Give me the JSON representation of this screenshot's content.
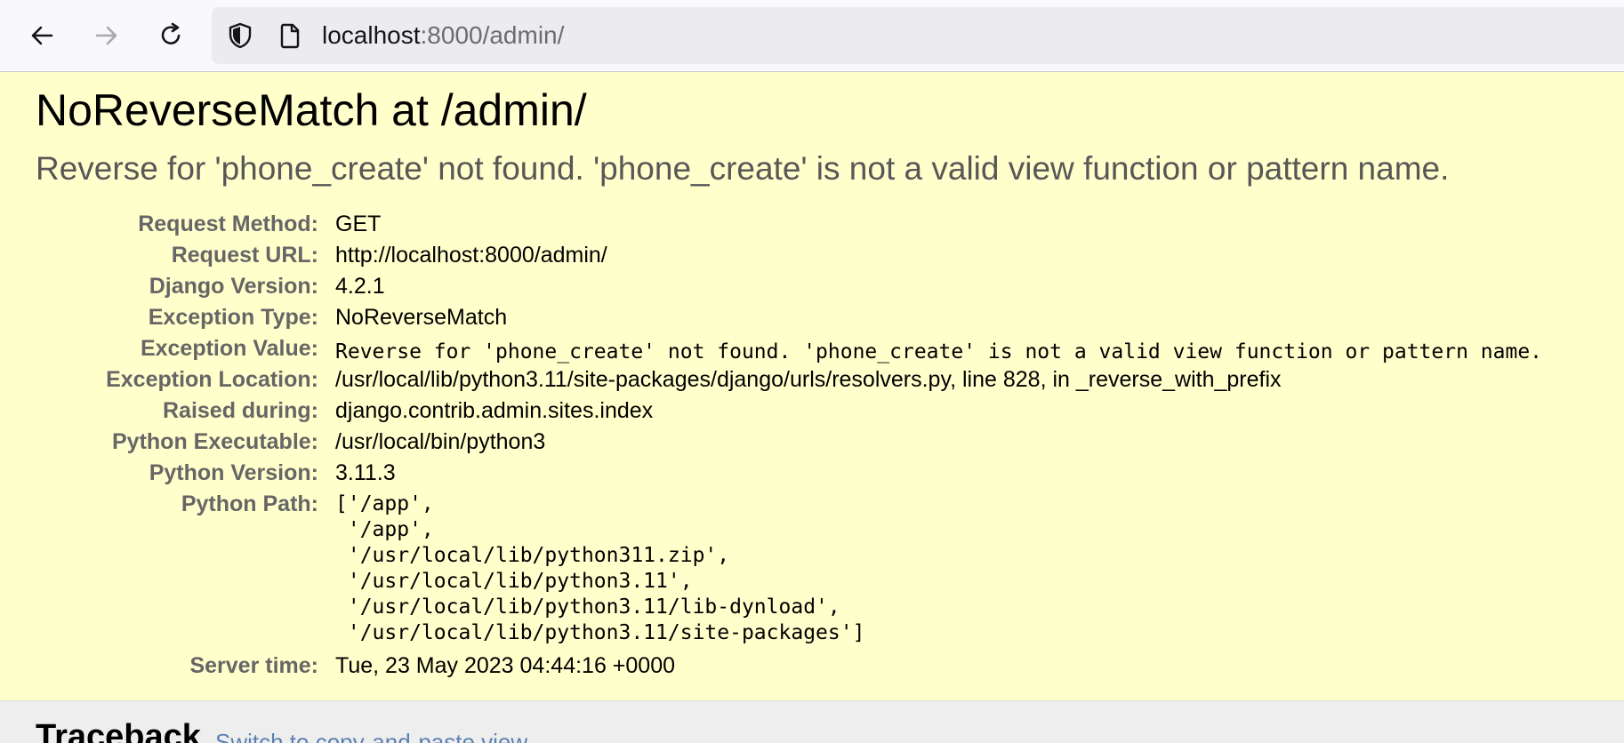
{
  "browser": {
    "url_host": "localhost",
    "url_rest": ":8000/admin/",
    "icons": [
      "back-arrow-icon",
      "forward-arrow-icon",
      "reload-icon",
      "shield-icon",
      "page-icon"
    ]
  },
  "error": {
    "title": "NoReverseMatch at /admin/",
    "message": "Reverse for 'phone_create' not found. 'phone_create' is not a valid view function or pattern name."
  },
  "meta": {
    "request_method": {
      "label": "Request Method:",
      "value": "GET"
    },
    "request_url": {
      "label": "Request URL:",
      "value": "http://localhost:8000/admin/"
    },
    "django_version": {
      "label": "Django Version:",
      "value": "4.2.1"
    },
    "exception_type": {
      "label": "Exception Type:",
      "value": "NoReverseMatch"
    },
    "exception_value": {
      "label": "Exception Value:",
      "value": "Reverse for 'phone_create' not found. 'phone_create' is not a valid view function or pattern name."
    },
    "exception_location": {
      "label": "Exception Location:",
      "value": "/usr/local/lib/python3.11/site-packages/django/urls/resolvers.py, line 828, in _reverse_with_prefix"
    },
    "raised_during": {
      "label": "Raised during:",
      "value": "django.contrib.admin.sites.index"
    },
    "python_executable": {
      "label": "Python Executable:",
      "value": "/usr/local/bin/python3"
    },
    "python_version": {
      "label": "Python Version:",
      "value": "3.11.3"
    },
    "python_path": {
      "label": "Python Path:",
      "lines": [
        "['/app',",
        " '/app',",
        " '/usr/local/lib/python311.zip',",
        " '/usr/local/lib/python3.11',",
        " '/usr/local/lib/python3.11/lib-dynload',",
        " '/usr/local/lib/python3.11/site-packages']"
      ]
    },
    "server_time": {
      "label": "Server time:",
      "value": "Tue, 23 May 2023 04:44:16 +0000"
    }
  },
  "traceback": {
    "heading": "Traceback",
    "switch_link": "Switch to copy-and-paste view"
  },
  "colors": {
    "summary_bg": "#ffffcc",
    "label": "#666666",
    "subtitle": "#575757",
    "link": "#5b80b2",
    "traceback_bg": "#eeeeee"
  }
}
